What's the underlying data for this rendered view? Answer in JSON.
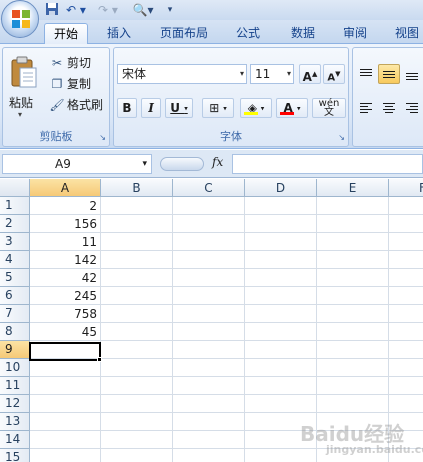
{
  "quick_access": {
    "save_icon": "save-icon",
    "undo_icon": "undo-icon",
    "redo_icon": "redo-icon",
    "preview_icon": "print-preview-icon"
  },
  "tabs": [
    "开始",
    "插入",
    "页面布局",
    "公式",
    "数据",
    "审阅",
    "视图"
  ],
  "active_tab": "开始",
  "clipboard": {
    "paste_label": "粘贴",
    "cut_label": "剪切",
    "copy_label": "复制",
    "format_painter_label": "格式刷",
    "group_label": "剪贴板"
  },
  "font": {
    "name": "宋体",
    "size": "11",
    "grow_label": "A",
    "shrink_label": "A",
    "bold_label": "B",
    "italic_label": "I",
    "underline_label": "U",
    "font_color_label": "A",
    "phonetic_label": "wén",
    "phonetic_char": "文",
    "group_label": "字体",
    "highlight_color": "#ffff00",
    "font_color": "#ff0000"
  },
  "formula_bar": {
    "name_box": "A9",
    "fx_label": "fx",
    "formula": ""
  },
  "sheet": {
    "columns": [
      "A",
      "B",
      "C",
      "D",
      "E",
      "F"
    ],
    "rows": [
      "1",
      "2",
      "3",
      "4",
      "5",
      "6",
      "7",
      "8",
      "9",
      "10",
      "11",
      "12",
      "13",
      "14",
      "15"
    ],
    "column_a_values": [
      "2",
      "156",
      "11",
      "142",
      "42",
      "245",
      "758",
      "45"
    ],
    "selected_cell": "A9"
  },
  "watermark": {
    "text": "Baidu经验",
    "sub": "jingyan.baidu.com"
  }
}
